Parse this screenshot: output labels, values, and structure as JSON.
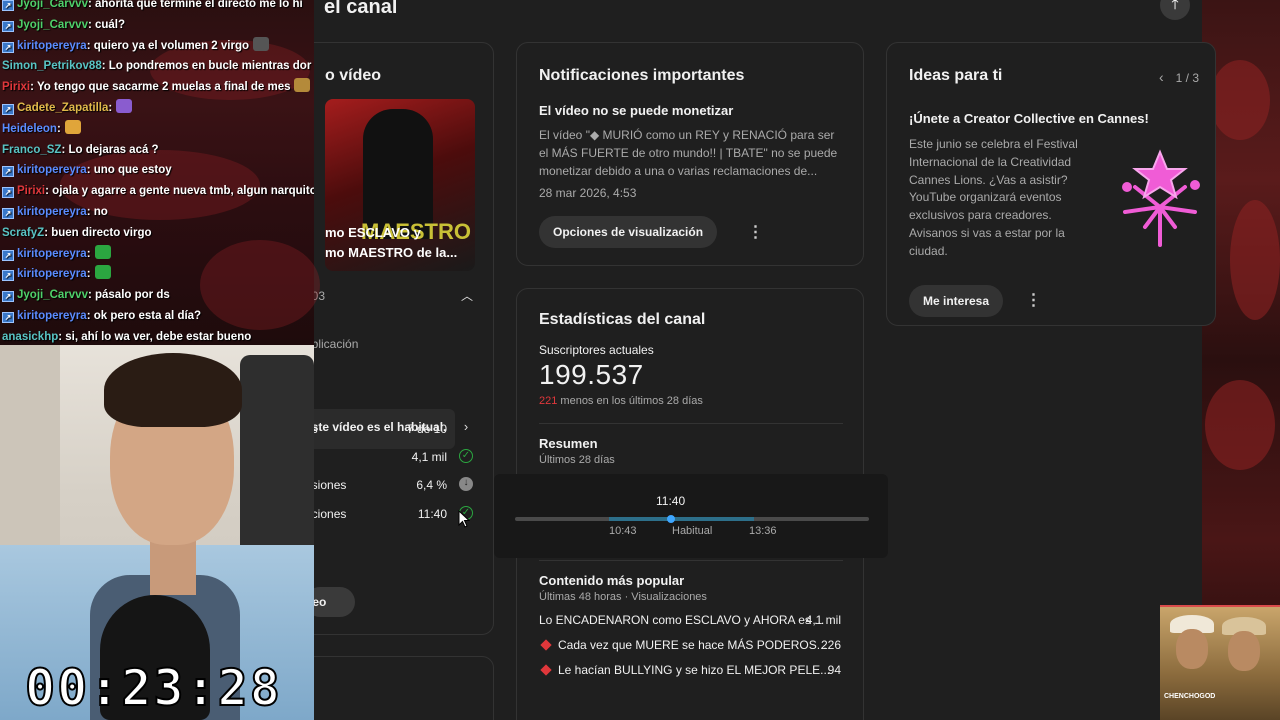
{
  "studio": {
    "title": "el canal",
    "video_card": {
      "title": "o vídeo",
      "thumb_caption_1": "mo ESCLAVO y",
      "thumb_caption_2": "mo MAESTRO de la...",
      "thumb_overlay": "MAESTRO",
      "id_fragment": "703",
      "section_label": "ublicación",
      "note": "este vídeo es el habitual.",
      "rows": [
        {
          "label": "es",
          "value": "7 de 10"
        },
        {
          "label": "",
          "value": "4,1 mil"
        },
        {
          "label": "esiones",
          "value": "6,4 %"
        },
        {
          "label": "aciones",
          "value": "11:40"
        }
      ],
      "button_label": "deo"
    },
    "notifications": {
      "title": "Notificaciones importantes",
      "subtitle": "El vídeo no se puede monetizar",
      "text": "El vídeo \"◆ MURIÓ como un REY y RENACIÓ para ser el MÁS FUERTE de otro mundo!! | TBATE\" no se puede monetizar debido a una o varias reclamaciones de...",
      "date": "28 mar 2026, 4:53",
      "button": "Opciones de visualización"
    },
    "stats": {
      "title": "Estadísticas del canal",
      "subs_label": "Suscriptores actuales",
      "subs_value": "199.537",
      "delta_value": "221",
      "delta_text": " menos en los últimos 28 días",
      "summary_title": "Resumen",
      "summary_sub": "Últimos 28 días",
      "popular_title": "Contenido más popular",
      "popular_sub": "Últimas 48 horas · Visualizaciones",
      "popular": [
        {
          "title": "Lo ENCADENARON como ESCLAVO y AHORA es ...",
          "views": "4,1 mil",
          "diamond": false
        },
        {
          "title": "Cada vez que MUERE se hace MÁS PODEROS...",
          "views": "226",
          "diamond": true
        },
        {
          "title": "Le hacían BULLYING y se hizo EL MEJOR PELE...",
          "views": "94",
          "diamond": true
        }
      ]
    },
    "ideas": {
      "title": "Ideas para ti",
      "pager": "1 / 3",
      "headline": "¡Únete a Creator Collective en Cannes!",
      "text": "Este junio se celebra el Festival Internacional de la Creatividad Cannes Lions. ¿Vas a asistir? YouTube organizará eventos exclusivos para creadores. Avisanos si vas a estar por la ciudad.",
      "button": "Me interesa"
    },
    "tooltip": {
      "value": "11:40",
      "low": "10:43",
      "mid": "Habitual",
      "high": "13:36",
      "marker_fraction": 0.44
    }
  },
  "chat": [
    {
      "user": "Jyoji_Carvvv",
      "color": "#4fd06a",
      "badge": true,
      "text": ": ahorita que termine el directo me lo hi"
    },
    {
      "user": "Jyoji_Carvvv",
      "color": "#4fd06a",
      "badge": true,
      "text": ": cuál?"
    },
    {
      "user": "kiritopereyra",
      "color": "#5b8cff",
      "badge": true,
      "text": ": quiero ya el volumen 2 virgo",
      "emote": "#555"
    },
    {
      "user": "Simon_Petrikov88",
      "color": "#59c4c4",
      "badge": false,
      "text": ": Lo pondremos en bucle mientras dor"
    },
    {
      "user": "Pirixi",
      "color": "#e0373b",
      "badge": false,
      "text": ": Yo tengo que sacarme 2 muelas a final de mes",
      "emote": "#b48a3a"
    },
    {
      "user": "Cadete_Zapatilla",
      "color": "#e0b94a",
      "badge": true,
      "text": ":",
      "emote": "#8a5ccf"
    },
    {
      "user": "Heideleon",
      "color": "#5b8cff",
      "badge": false,
      "text": ":",
      "emote": "#e0a53a"
    },
    {
      "user": "Franco_SZ",
      "color": "#59c4c4",
      "badge": false,
      "text": ": Lo dejaras acá ?"
    },
    {
      "user": "kiritopereyra",
      "color": "#5b8cff",
      "badge": true,
      "text": ": uno que estoy"
    },
    {
      "user": "Pirixi",
      "color": "#e0373b",
      "badge": true,
      "text": ": ojala y agarre a gente nueva tmb, algun narquito r"
    },
    {
      "user": "kiritopereyra",
      "color": "#5b8cff",
      "badge": true,
      "text": ": no"
    },
    {
      "user": "ScrafyZ",
      "color": "#59c4c4",
      "badge": false,
      "text": ": buen directo virgo"
    },
    {
      "user": "kiritopereyra",
      "color": "#5b8cff",
      "badge": true,
      "text": ":",
      "emote": "#2ba640"
    },
    {
      "user": "kiritopereyra",
      "color": "#5b8cff",
      "badge": true,
      "text": ":",
      "emote": "#2ba640"
    },
    {
      "user": "Jyoji_Carvvv",
      "color": "#4fd06a",
      "badge": true,
      "text": ": pásalo por ds"
    },
    {
      "user": "kiritopereyra",
      "color": "#5b8cff",
      "badge": true,
      "text": ": ok pero esta al día?"
    },
    {
      "user": "anasickhp",
      "color": "#59c4c4",
      "badge": false,
      "text": ": si, ahí lo wa ver, debe estar bueno"
    }
  ],
  "timer": "00:23:28",
  "cam2_label": "CHENCHOGOD"
}
